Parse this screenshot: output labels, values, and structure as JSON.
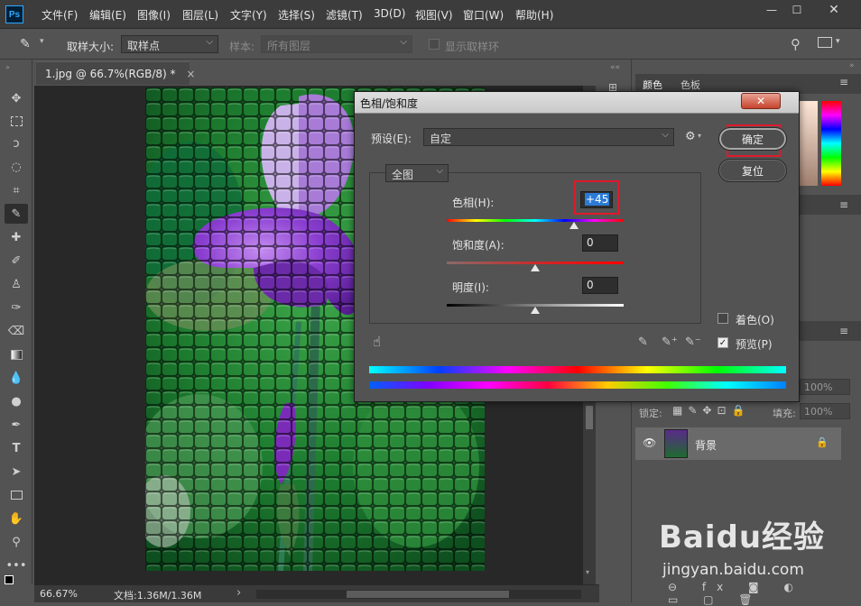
{
  "app": {
    "logo_text": "Ps",
    "menu": [
      "文件(F)",
      "编辑(E)",
      "图像(I)",
      "图层(L)",
      "文字(Y)",
      "选择(S)",
      "滤镜(T)",
      "3D(D)",
      "视图(V)",
      "窗口(W)",
      "帮助(H)"
    ]
  },
  "options_bar": {
    "sample_size_label": "取样大小:",
    "sample_size_value": "取样点",
    "sample_label": "样本:",
    "sample_value": "所有图层",
    "show_ring_label": "显示取样环"
  },
  "document": {
    "tab_title": "1.jpg @ 66.7%(RGB/8) *",
    "tab_close": "×",
    "zoom": "66.67%",
    "doc_info": "文档:1.36M/1.36M",
    "status_arrow": "›"
  },
  "panels": {
    "color_tab": "颜色",
    "swatches_tab": "色板",
    "layer_name": "背景",
    "opacity_value": "100%",
    "fill_value": "100%",
    "lock_label": "锁定:",
    "fill_label": "填充:"
  },
  "dialog": {
    "title": "色相/饱和度",
    "preset_label": "预设(E):",
    "preset_value": "自定",
    "channel_value": "全图",
    "hue_label": "色相(H):",
    "hue_value": "+45",
    "saturation_label": "饱和度(A):",
    "saturation_value": "0",
    "lightness_label": "明度(I):",
    "lightness_value": "0",
    "ok_label": "确定",
    "reset_label": "复位",
    "colorize_label": "着色(O)",
    "colorize_checked": false,
    "preview_label": "预览(P)",
    "preview_checked": true,
    "hue_slider_fraction": 0.72,
    "saturation_slider_fraction": 0.5,
    "lightness_slider_fraction": 0.5
  },
  "watermark": {
    "brand": "Baidu经验",
    "url": "jingyan.baidu.com"
  },
  "colors": {
    "highlight_box": "#e0192a",
    "selection": "#2b7bd6"
  }
}
